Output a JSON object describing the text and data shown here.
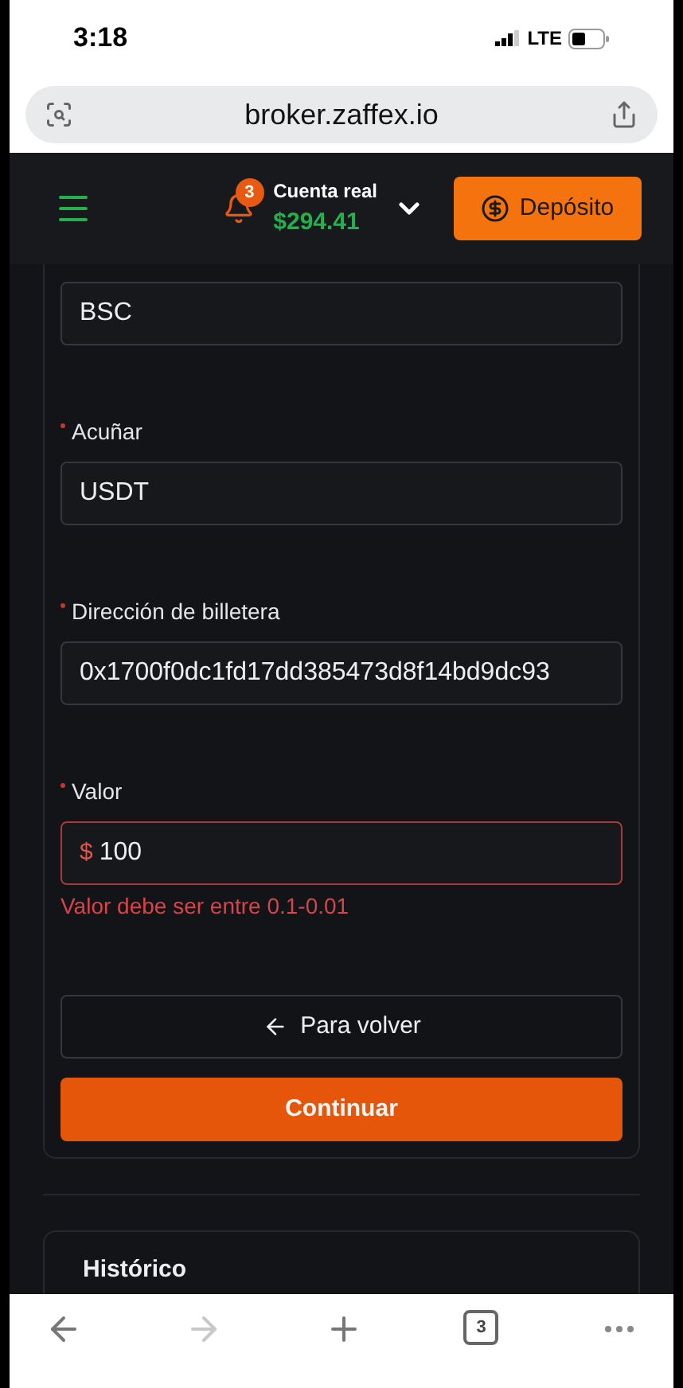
{
  "status_bar": {
    "time": "3:18",
    "network": "LTE"
  },
  "browser": {
    "url": "broker.zaffex.io"
  },
  "header": {
    "notifications": "3",
    "account_label": "Cuenta real",
    "balance": "$294.41",
    "deposit_button": "Depósito"
  },
  "form": {
    "fields": [
      {
        "value": "BSC",
        "invalid": false
      },
      {
        "label": "Acuñar",
        "required": true,
        "value": "USDT",
        "invalid": false
      },
      {
        "label": "Dirección de billetera",
        "required": true,
        "value": "0x1700f0dc1fd17dd385473d8f14bd9dc93",
        "invalid": false
      },
      {
        "label": "Valor",
        "required": true,
        "prefix": "$",
        "value": "100",
        "invalid": true,
        "error": "Valor debe ser entre 0.1-0.01"
      }
    ],
    "back_button": "Para volver",
    "continue_button": "Continuar"
  },
  "history": {
    "title": "Histórico"
  },
  "toolbar": {
    "back_disabled": false,
    "forward_disabled": true,
    "tab_count": "3"
  }
}
